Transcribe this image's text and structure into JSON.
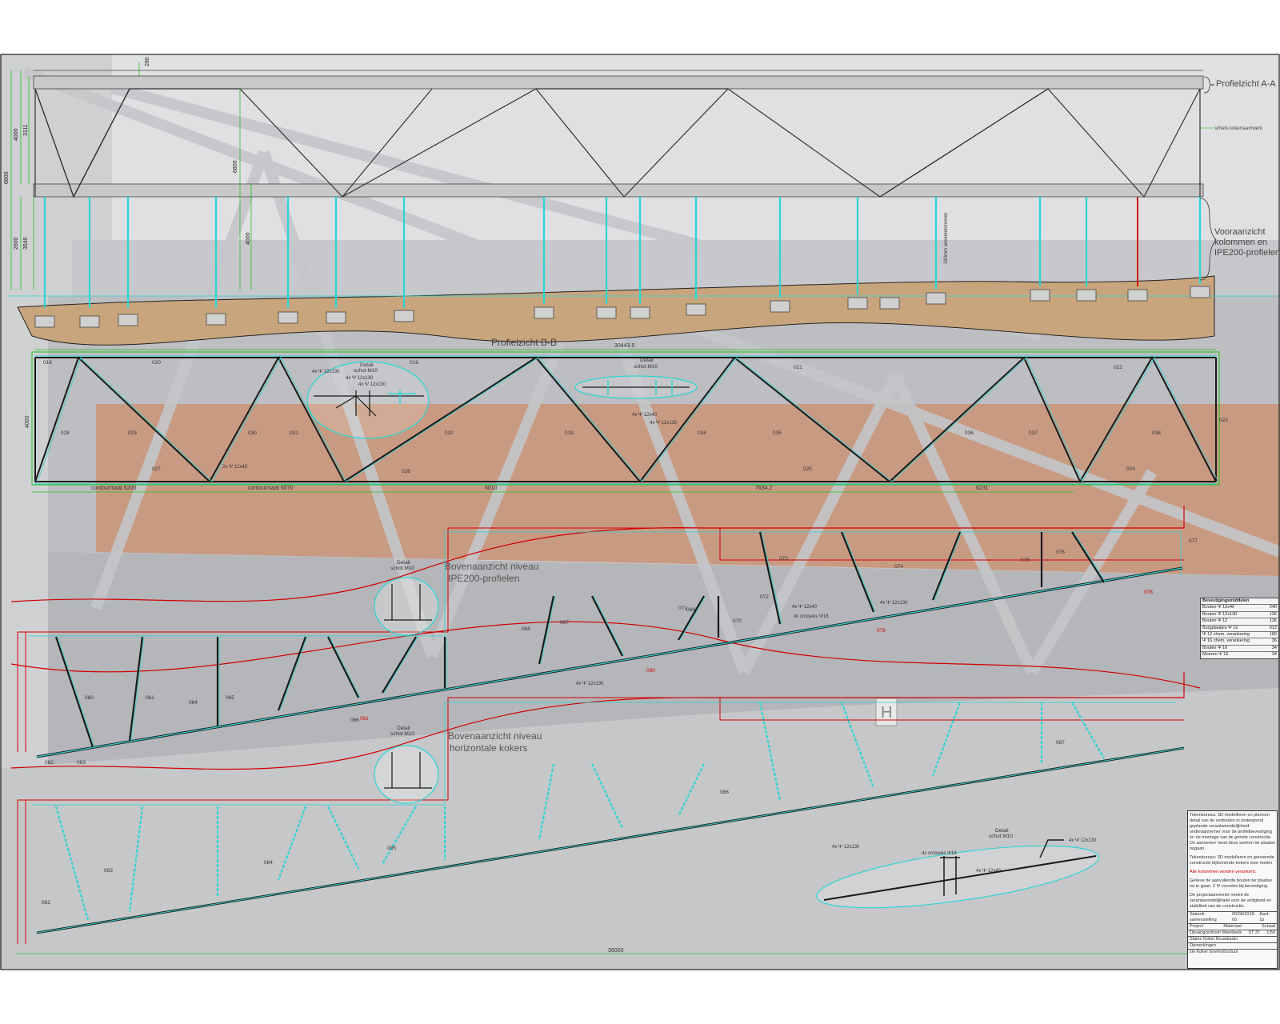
{
  "views": {
    "profile_aa": "Profielzicht A-A",
    "front": "Vooraanzicht\nkolommen en\nIPE200-profielen",
    "profile_bb": "Profielzicht B-B",
    "top_ipe": "Bovenaanzicht niveau\nIPE200-profielen",
    "top_kokers": "Bovenaanzicht niveau\nhorizontale kokers"
  },
  "dimensions": {
    "d6800": "6800",
    "d4000": "4000",
    "d2600": "2600",
    "d3111": "3111",
    "d3540": "3540",
    "d_top": "280",
    "d6800b": "6800",
    "d4000b": "4000",
    "total_bb": "30443.5",
    "total_plan": "36000",
    "seg1": "contourmaat 6200",
    "seg2": "contourmaat 6070",
    "seg3": "6010",
    "seg4": "7634.2",
    "seg5": "6231"
  },
  "annotations": {
    "kokerramen": "schets kokerraamwerk",
    "kolom_note": "160mm ankerkolommen",
    "detail1": "Detail\nschot M10",
    "detail2": "Detail\nschot M10",
    "detail3": "Detail\nschot M10",
    "detail4": "Detail\nschot M10",
    "bolt1": "4x Ψ 12x130",
    "bolt2": "4x Ψ 12x130",
    "bolt3": "4x Ψ 12x130",
    "bolt4": "2x Ψ 12x40",
    "bolt5": "4x Ψ 12x40",
    "bolt6": "4x Ψ 12x40",
    "bolt7": "4x Ψ 12x130",
    "bolt8": "4x Ψ 12x130",
    "bolt9": "4x Ψ 12x40",
    "bolt10": "4x croisees Ψ16",
    "bolt11": "4x croisees Ψ16",
    "bolt12": "4x Ψ 12x130"
  },
  "member_labels": {
    "bb_top": [
      "020",
      "019",
      "021",
      "022"
    ],
    "bb_diag": [
      "028",
      "029",
      "030",
      "031",
      "032",
      "033",
      "034",
      "035",
      "036",
      "037",
      "038"
    ],
    "bb_bottom": [
      "027",
      "026",
      "025",
      "024"
    ],
    "bb_side": [
      "018",
      "023"
    ],
    "plan_ipe": [
      "060",
      "061",
      "062",
      "063",
      "064",
      "065",
      "066",
      "067",
      "068",
      "069",
      "070",
      "071",
      "072",
      "073",
      "074",
      "075",
      "076",
      "077"
    ],
    "plan_red": [
      "080",
      "079",
      "078",
      "081"
    ],
    "plan_koker": [
      "082",
      "083",
      "084",
      "085",
      "086",
      "087"
    ]
  },
  "legend": {
    "title": "Bevestigingsmiddelen",
    "rows": [
      {
        "name": "Bouten Ψ 12x40",
        "qty": "240"
      },
      {
        "name": "Bouten Ψ 12x130",
        "qty": "136"
      },
      {
        "name": "Bouten Ψ 12",
        "qty": "136"
      },
      {
        "name": "Borgplaatjes Ψ 12",
        "qty": "512"
      },
      {
        "name": "Ψ 12 chem. verankering",
        "qty": "180"
      },
      {
        "name": "Ψ 16 chem. verankering",
        "qty": "36"
      },
      {
        "name": "Bouten Ψ 16",
        "qty": "34"
      },
      {
        "name": "Moeren Ψ 16",
        "qty": "34"
      }
    ]
  },
  "titleblock": {
    "notes1": "Tekenbureau: 3D-modelleren en plannen detail van de verbinden in ondergrond geplande verantwoordelijkheid: onderaannemer voor de profielbevestiging en de montage van de gehele constructie. De aannemer moet deze werken ter plaatse nagaan.",
    "notes2": "Tekenbureau: 3D modelleren en genoemde constructie bijkomende kokers voor meten",
    "red_note": "Alle kolommen worden verankerd.",
    "notes3": "Gelieve de aanvullende bouten ter plaatse na te gaan. 2 Ψ voorzien bij bevestiging.",
    "notes4": "De projectaannemer neemt de verantwoordelijkheid voor de veiligheid en stabiliteit van de constructie.",
    "r1_label": "Stalenk. samenstelling",
    "r1_date": "00/00/2018-00",
    "r1_rev": "Aant. 1p",
    "r2_label": "Project",
    "r2_val": "Opvangcentrum Meerbeek",
    "r2_mat": "Materiaal",
    "r2_matv": "ST 37",
    "r2_sch": "Schaal",
    "r2_schv": "1/50",
    "r3_label": "Stalen Koker Bouwkader",
    "r4_label": "Opmerkingen",
    "r5_label": "zie Koker bovenstructuur"
  }
}
